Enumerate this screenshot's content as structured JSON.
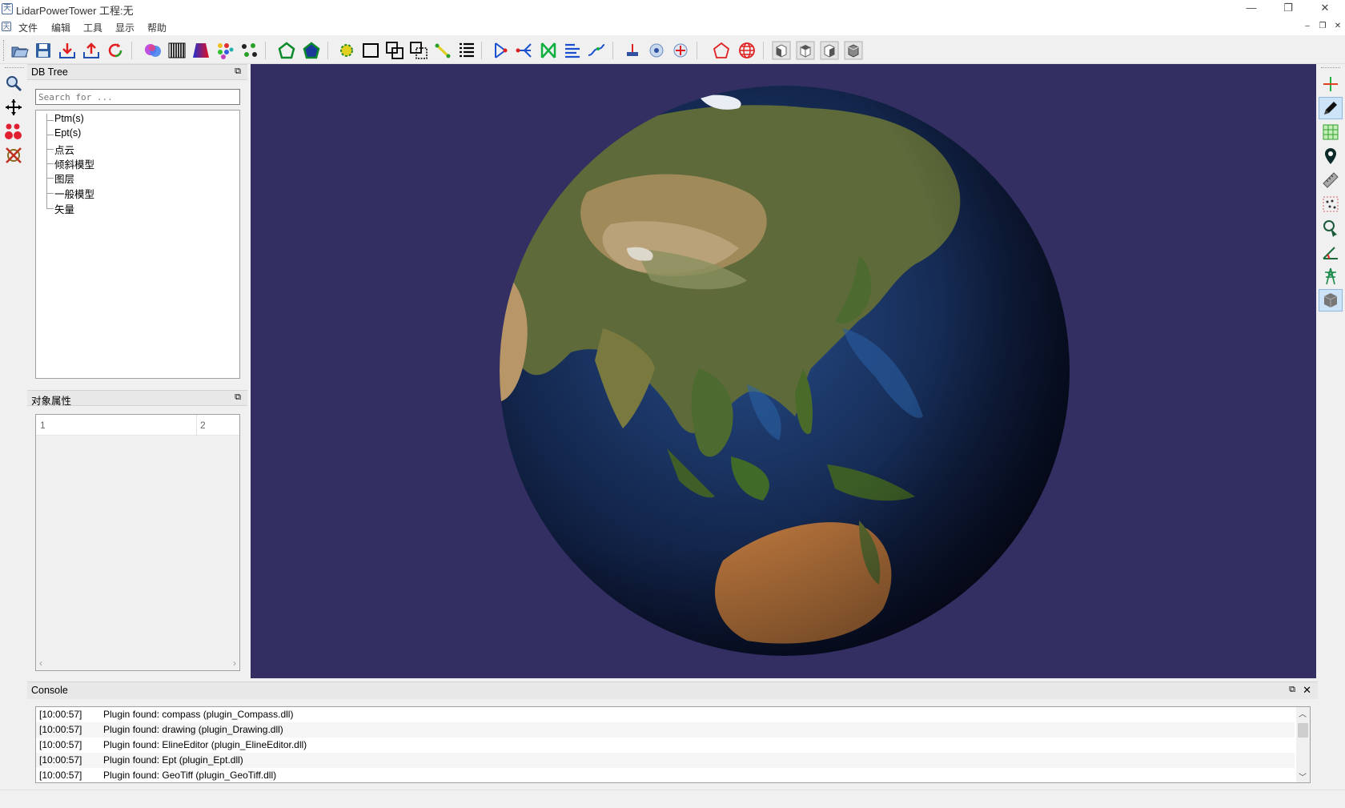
{
  "window": {
    "title": "LidarPowerTower 工程:无",
    "app_icon_glyph": "天",
    "minimize": "—",
    "restore": "❐",
    "close": "✕"
  },
  "menu": {
    "items": [
      "文件",
      "编辑",
      "工具",
      "显示",
      "帮助"
    ],
    "mdi_controls": [
      "–",
      "❐",
      "✕"
    ]
  },
  "toolbar": {
    "icons": [
      "open-icon",
      "save-icon",
      "import-icon",
      "export-icon",
      "refresh-icon",
      "color-blend-icon",
      "barcode-icon",
      "trapezoid-icon",
      "color-dots-icon",
      "scatter-dots-icon",
      "polygon-outline-icon",
      "polygon-filled-icon",
      "point-select-icon",
      "rectangle-select-icon",
      "union-icon",
      "difference-icon",
      "line-snap-icon",
      "list-icon",
      "segment-icon",
      "branch-icon",
      "cross-lines-icon",
      "align-icon",
      "curve-icon",
      "marker-down-icon",
      "target-icon",
      "globe-pin-icon",
      "pentagon-icon",
      "grid-globe-icon",
      "view-left-icon",
      "view-top-icon",
      "view-right-icon",
      "view-iso-icon"
    ]
  },
  "left_toolbar": {
    "icons": [
      "zoom-icon",
      "pan-icon",
      "red-dots-icon",
      "clear-icon"
    ]
  },
  "right_toolbar": {
    "icons": [
      "axis-cross-icon",
      "pencil-icon",
      "grid-icon",
      "location-pin-icon",
      "ruler-icon",
      "point-grid-icon",
      "pick-point-icon",
      "angle-icon",
      "tower-icon",
      "cube-icon"
    ]
  },
  "db_tree": {
    "title": "DB Tree",
    "search_placeholder": "Search for ...",
    "items": [
      "Ptm(s)",
      "Ept(s)",
      "点云",
      "倾斜模型",
      "图层",
      "一般模型",
      "矢量"
    ]
  },
  "properties": {
    "title": "对象属性",
    "columns": [
      "1",
      "2"
    ]
  },
  "viewport": {
    "background": "#332f62",
    "content": "globe-earth-asia"
  },
  "console": {
    "title": "Console",
    "lines": [
      {
        "time": "[10:00:57]",
        "message": "Plugin found: compass (plugin_Compass.dll)"
      },
      {
        "time": "[10:00:57]",
        "message": "Plugin found: drawing (plugin_Drawing.dll)"
      },
      {
        "time": "[10:00:57]",
        "message": "Plugin found: ElineEditor (plugin_ElineEditor.dll)"
      },
      {
        "time": "[10:00:57]",
        "message": "Plugin found: Ept (plugin_Ept.dll)"
      },
      {
        "time": "[10:00:57]",
        "message": "Plugin found: GeoTiff (plugin_GeoTiff.dll)"
      }
    ]
  }
}
